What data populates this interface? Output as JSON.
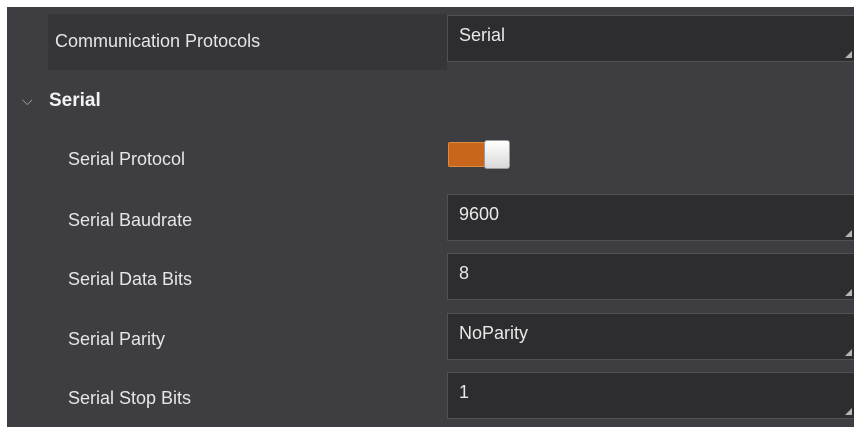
{
  "communication": {
    "label": "Communication Protocols",
    "value": "Serial"
  },
  "section": {
    "title": "Serial",
    "expanded": true
  },
  "serial": {
    "protocol": {
      "label": "Serial Protocol",
      "enabled": true
    },
    "baudrate": {
      "label": "Serial Baudrate",
      "value": "9600"
    },
    "data_bits": {
      "label": "Serial Data Bits",
      "value": "8"
    },
    "parity": {
      "label": "Serial Parity",
      "value": "NoParity"
    },
    "stop_bits": {
      "label": "Serial Stop Bits",
      "value": "1"
    }
  },
  "colors": {
    "panel_bg": "#3e3e42",
    "field_bg": "#2d2d30",
    "toggle_on": "#c8661e"
  },
  "icons": {
    "section_toggle": "chevron-down-icon",
    "resize_grip": "resize-grip-icon"
  }
}
